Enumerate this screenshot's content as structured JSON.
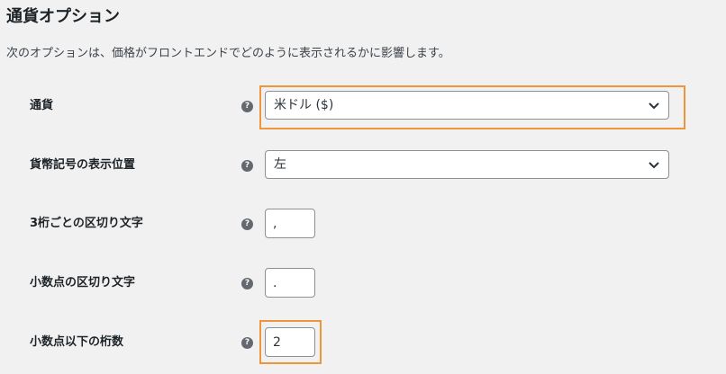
{
  "section": {
    "title": "通貨オプション",
    "description": "次のオプションは、価格がフロントエンドでどのように表示されるかに影響します。"
  },
  "help_icon_glyph": "?",
  "rows": [
    {
      "label": "通貨",
      "control": "select",
      "value": "米ドル ($)",
      "highlighted": true
    },
    {
      "label": "貨幣記号の表示位置",
      "control": "select",
      "value": "左",
      "highlighted": false
    },
    {
      "label": "3桁ごとの区切り文字",
      "control": "text",
      "value": ",",
      "highlighted": false
    },
    {
      "label": "小数点の区切り文字",
      "control": "text",
      "value": ".",
      "highlighted": false
    },
    {
      "label": "小数点以下の桁数",
      "control": "text",
      "value": "2",
      "highlighted": true
    }
  ],
  "colors": {
    "highlight": "#f0953a",
    "background": "#f1f1f1",
    "border": "#8c8f94"
  }
}
